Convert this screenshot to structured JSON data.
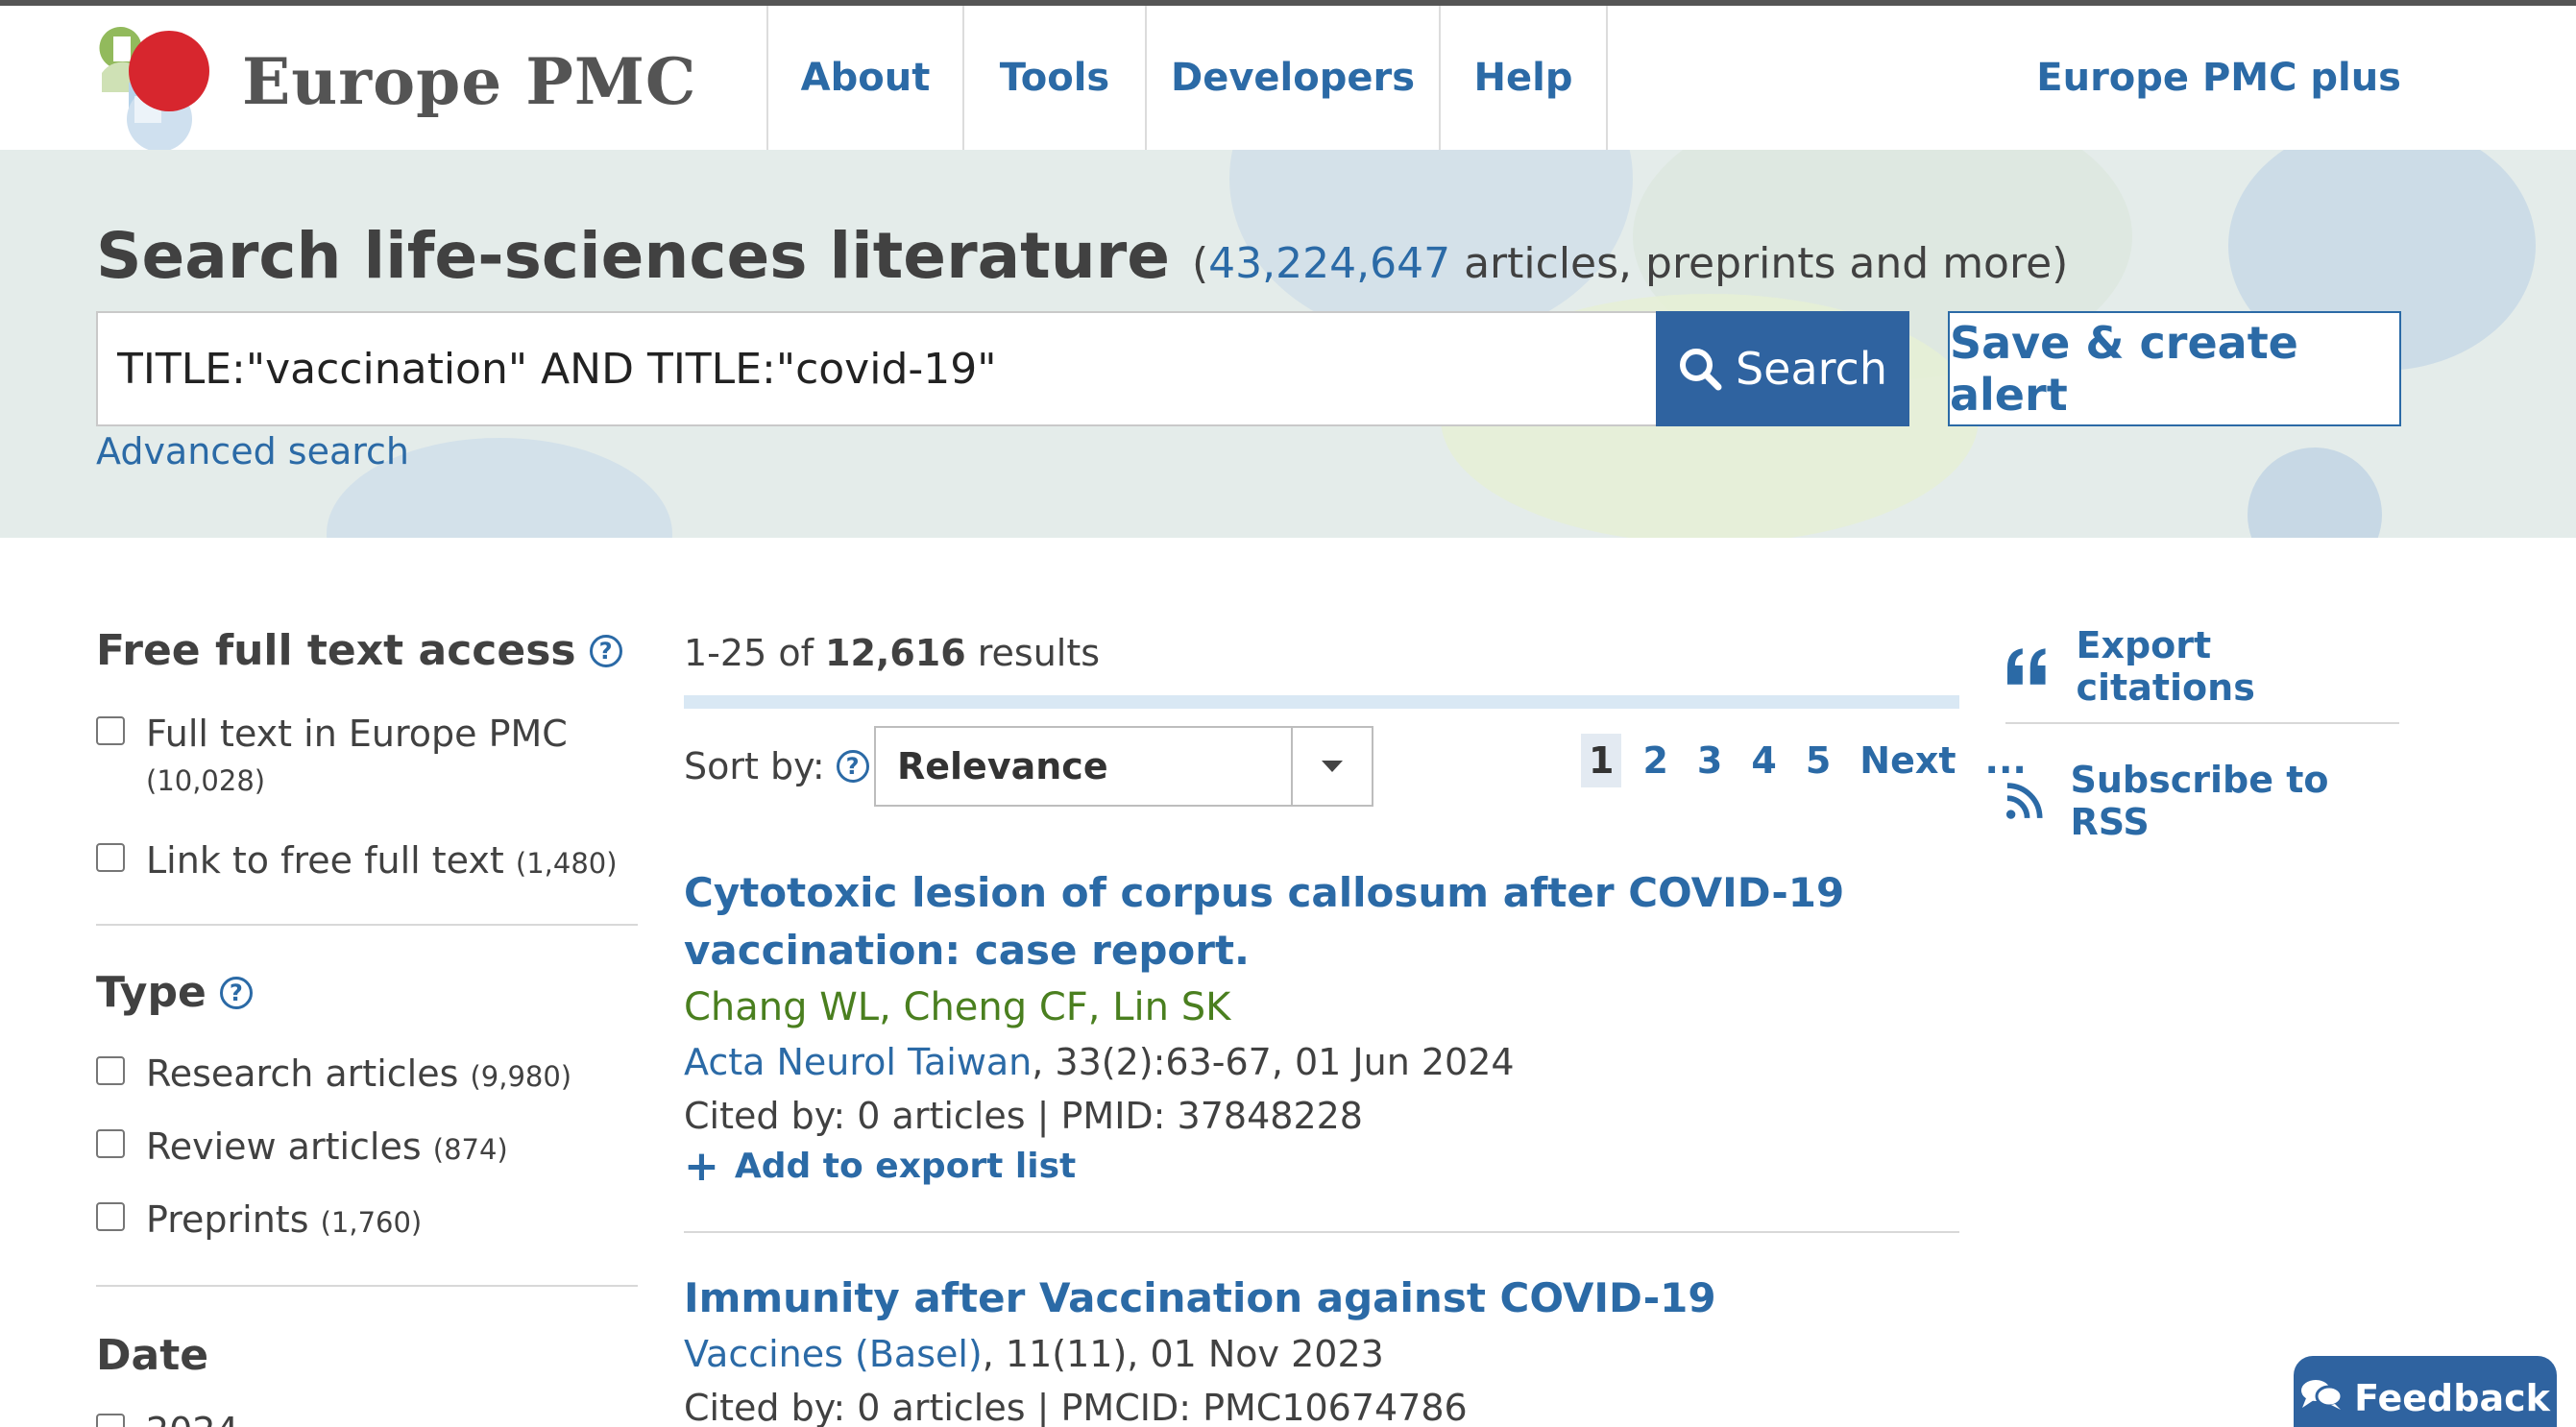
{
  "header": {
    "logo_text": "Europe PMC",
    "nav": [
      {
        "label": "About"
      },
      {
        "label": "Tools"
      },
      {
        "label": "Developers"
      },
      {
        "label": "Help"
      }
    ],
    "plus_link": "Europe PMC plus"
  },
  "hero": {
    "title": "Search life-sciences literature",
    "count_open": "(",
    "count": "43,224,647",
    "count_suffix": " articles, preprints and more)",
    "search_value": "TITLE:\"vaccination\" AND TITLE:\"covid-19\"",
    "search_button": "Search",
    "alert_button": "Save & create alert",
    "advanced_link": "Advanced search"
  },
  "sidebar": {
    "free_full_text": {
      "title": "Free full text access",
      "options": [
        {
          "label": "Full text in Europe PMC",
          "count": "(10,028)"
        },
        {
          "label": "Link to free full text",
          "count": "(1,480)"
        }
      ]
    },
    "type": {
      "title": "Type",
      "options": [
        {
          "label": "Research articles",
          "count": "(9,980)"
        },
        {
          "label": "Review articles",
          "count": "(874)"
        },
        {
          "label": "Preprints",
          "count": "(1,760)"
        }
      ]
    },
    "date": {
      "title": "Date",
      "first_option": "2024"
    }
  },
  "results": {
    "range": "1-25 of ",
    "total": "12,616",
    "suffix": " results",
    "sort_label": "Sort by:",
    "sort_value": "Relevance",
    "pager": {
      "pages": [
        "1",
        "2",
        "3",
        "4",
        "5"
      ],
      "current": "1",
      "next": "Next",
      "ellipsis": "..."
    },
    "articles": [
      {
        "title": "Cytotoxic lesion of corpus callosum after COVID-19 vaccination: case report.",
        "authors": "Chang WL, Cheng CF, Lin SK",
        "journal": "Acta Neurol Taiwan",
        "citation": ", 33(2):63-67, 01 Jun 2024",
        "cited": "Cited by: 0 articles | PMID: 37848228",
        "add_label": "Add to export list"
      },
      {
        "title": "Immunity after Vaccination against COVID-19",
        "journal": "Vaccines (Basel)",
        "citation": ", 11(11), 01 Nov 2023",
        "cited": "Cited by: 0 articles | PMCID: PMC10674786"
      }
    ]
  },
  "rail": {
    "export": "Export citations",
    "rss": "Subscribe to RSS"
  },
  "feedback": "Feedback",
  "colors": {
    "link": "#2b6aa6",
    "primary_button": "#2f63a0",
    "authors": "#4a7f1f",
    "logo_red": "#d7262e"
  },
  "icons": [
    "logo-mark",
    "search-icon",
    "help-icon",
    "chevron-down-icon",
    "plus-icon",
    "quote-icon",
    "rss-icon",
    "chat-bubble-icon"
  ]
}
